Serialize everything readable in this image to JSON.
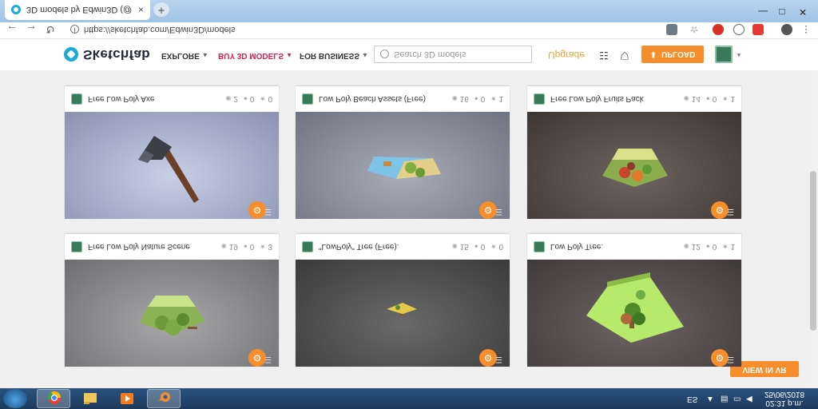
{
  "browser": {
    "tab_title": "3D models by Edwin3D (@Edwin",
    "tab_close": "×",
    "new_tab": "+",
    "url": "https://sketchfab.com/Edwin3D/models",
    "back_icon": "arrow-left-icon",
    "forward_icon": "arrow-right-icon",
    "reload_icon": "reload-icon",
    "min_glyph": "—",
    "max_glyph": "□",
    "close_glyph": "✕"
  },
  "header": {
    "logo_text": "Sketchfab",
    "nav": [
      {
        "label": "EXPLORE"
      },
      {
        "label": "BUY 3D MODELS"
      },
      {
        "label": "FOR BUSINESS"
      }
    ],
    "search_placeholder": "Search 3D models",
    "upgrade_label": "Upgrade",
    "upload_label": "UPLOAD",
    "upload_arrow": "⬇",
    "caret": "▲",
    "colors": {
      "accent": "#f58e2b",
      "brand": "#1caad9",
      "buy_link": "#d4224e"
    }
  },
  "view_in_vr_label": "VIEW IN VR",
  "models": [
    {
      "name": "Free Low Poly Nature Scene",
      "views": "19",
      "comments": "0",
      "likes": "3"
    },
    {
      "name": "\"LowPoly\" Tree (Free).",
      "views": "15",
      "comments": "0",
      "likes": "0"
    },
    {
      "name": "Low Poly Tree.",
      "views": "12",
      "comments": "0",
      "likes": "1"
    },
    {
      "name": "Free Low Poly Axe",
      "views": "2",
      "comments": "0",
      "likes": "0"
    },
    {
      "name": "Low Poly Beach Assets (Free)",
      "views": "16",
      "comments": "0",
      "likes": "1"
    },
    {
      "name": "Free Low Poly Fruits Pack",
      "views": "14",
      "comments": "0",
      "likes": "1"
    }
  ],
  "taskbar": {
    "language": "ES",
    "time": "02:31 p.m.",
    "date": "25/06/2018",
    "apps": [
      "chrome-icon",
      "file-explorer-icon",
      "media-player-icon",
      "blender-icon"
    ]
  }
}
